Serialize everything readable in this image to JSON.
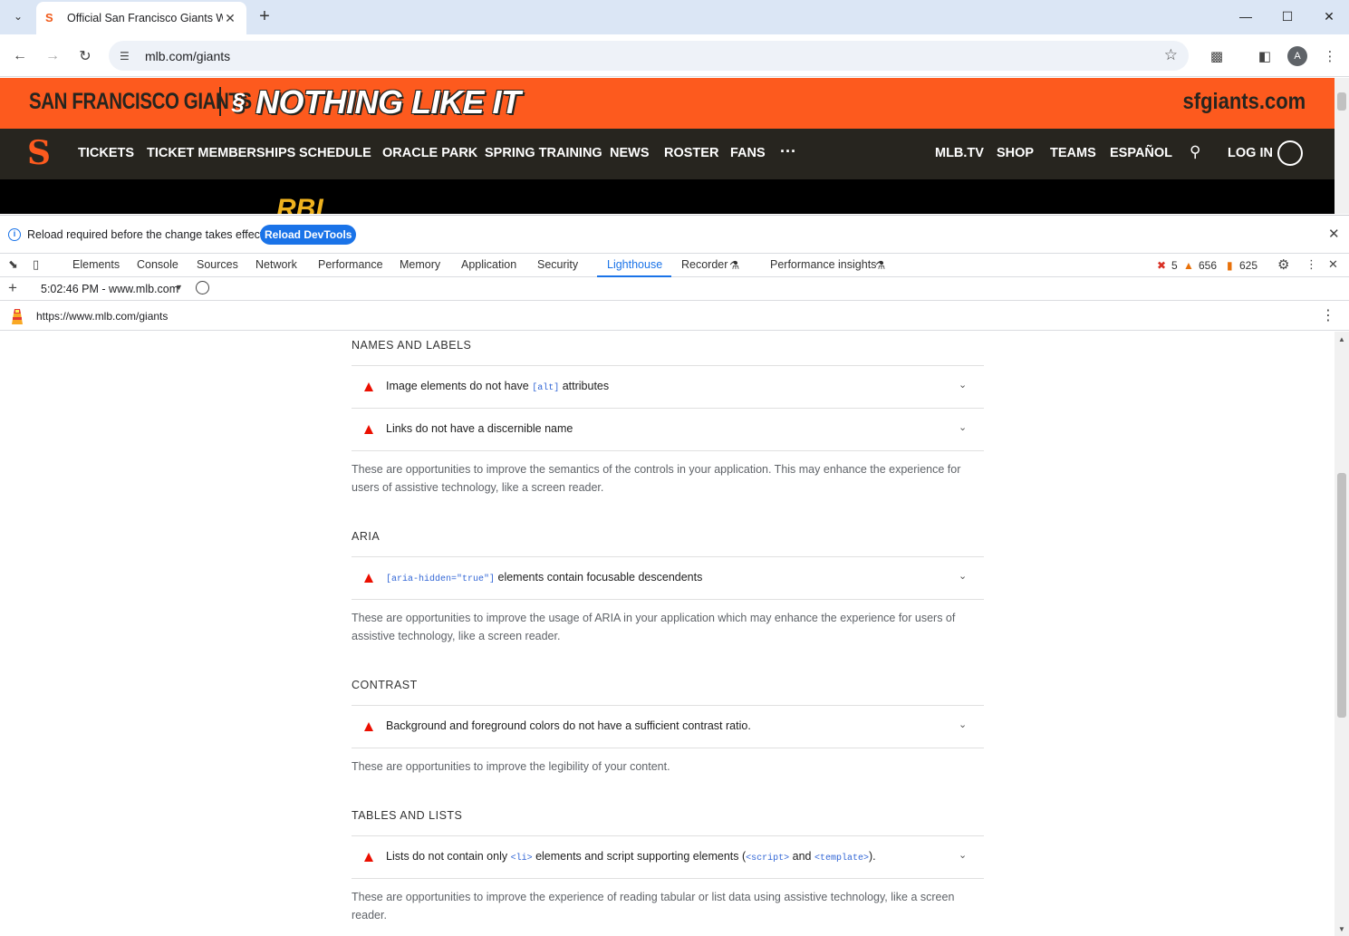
{
  "browser": {
    "tab_title": "Official San Francisco Giants We",
    "url": "mlb.com/giants",
    "profile_initial": "A"
  },
  "site": {
    "team_name": "SAN FRANCISCO GIANTS",
    "slogan": "NOTHING LIKE IT",
    "domain": "sfgiants.com",
    "nav_left": [
      "TICKETS",
      "TICKET MEMBERSHIPS",
      "SCHEDULE",
      "ORACLE PARK",
      "SPRING TRAINING",
      "NEWS",
      "ROSTER",
      "FANS",
      "···"
    ],
    "nav_right": [
      "MLB.TV",
      "SHOP",
      "TEAMS",
      "ESPAÑOL"
    ],
    "login": "LOG IN"
  },
  "devtools": {
    "infobar_message": "Reload required before the change takes effect.",
    "reload_button": "Reload DevTools",
    "tabs": [
      "Elements",
      "Console",
      "Sources",
      "Network",
      "Performance",
      "Memory",
      "Application",
      "Security",
      "Lighthouse",
      "Recorder",
      "Performance insights"
    ],
    "active_tab": "Lighthouse",
    "errors": "5",
    "warnings": "656",
    "issues": "625",
    "report_time": "5:02:46 PM - www.mlb.com",
    "report_url": "https://www.mlb.com/giants"
  },
  "report": {
    "groups": [
      {
        "title": "NAMES AND LABELS",
        "audits": [
          {
            "pre": "Image elements do not have ",
            "code": "[alt]",
            "post": " attributes"
          },
          {
            "pre": "Links do not have a discernible name",
            "code": "",
            "post": ""
          }
        ],
        "description": "These are opportunities to improve the semantics of the controls in your application. This may enhance the experience for users of assistive technology, like a screen reader."
      },
      {
        "title": "ARIA",
        "audits": [
          {
            "pre": "",
            "code": "[aria-hidden=\"true\"]",
            "post": " elements contain focusable descendents"
          }
        ],
        "description": "These are opportunities to improve the usage of ARIA in your application which may enhance the experience for users of assistive technology, like a screen reader."
      },
      {
        "title": "CONTRAST",
        "audits": [
          {
            "pre": "Background and foreground colors do not have a sufficient contrast ratio.",
            "code": "",
            "post": ""
          }
        ],
        "description": "These are opportunities to improve the legibility of your content."
      },
      {
        "title": "TABLES AND LISTS",
        "audits": [
          {
            "pre": "Lists do not contain only ",
            "code": "<li>",
            "mid": " elements and script supporting elements (",
            "code2": "<script>",
            "mid2": " and ",
            "code3": "<template>",
            "post": ")."
          }
        ],
        "description": "These are opportunities to improve the experience of reading tabular or list data using assistive technology, like a screen reader."
      }
    ]
  },
  "colors": {
    "giants_orange": "#fd5a1e",
    "giants_dark": "#27251f",
    "devtools_blue": "#1a73e8",
    "fail_red": "#eb0f00"
  }
}
